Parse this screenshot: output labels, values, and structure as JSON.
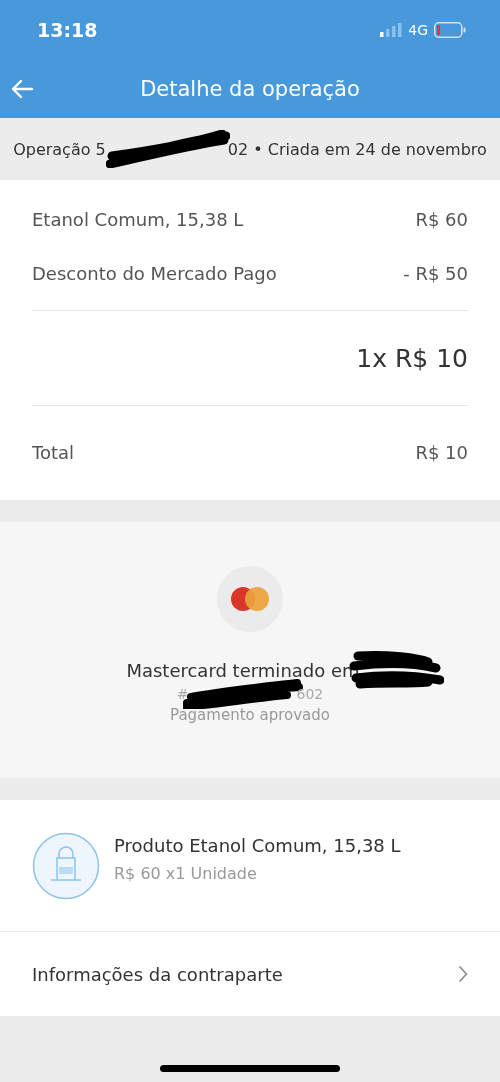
{
  "status_bar": {
    "time": "13:18",
    "network": "4G"
  },
  "header": {
    "title": "Detalhe da operação"
  },
  "operation": {
    "prefix": "Operação 5",
    "suffix": "02 • Criada em 24 de novembro"
  },
  "items": [
    {
      "label": "Etanol Comum, 15,38 L",
      "amount": "R$ 60"
    },
    {
      "label": "Desconto do Mercado Pago",
      "amount": "- R$ 50"
    }
  ],
  "installments": "1x R$ 10",
  "total": {
    "label": "Total",
    "amount": "R$ 10"
  },
  "payment": {
    "card": "Mastercard terminado em",
    "number_prefix": "#",
    "number_suffix": "602",
    "status": "Pagamento aprovado"
  },
  "product": {
    "name": "Produto Etanol Comum, 15,38 L",
    "detail": "R$ 60 x1 Unidade"
  },
  "counterpart": {
    "label": "Informações da contraparte"
  }
}
